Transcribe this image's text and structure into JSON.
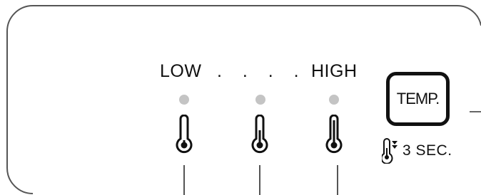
{
  "panel": {
    "level_low_label": "LOW",
    "level_dots": ". . . . .",
    "level_high_label": "HIGH",
    "indicators": [
      {
        "level": "low",
        "lit": false
      },
      {
        "level": "medium",
        "lit": false
      },
      {
        "level": "high",
        "lit": false
      }
    ],
    "temp_button_label": "TEMP.",
    "hold_duration_label": "3 SEC.",
    "icons": [
      "thermometer-low-icon",
      "thermometer-medium-icon",
      "thermometer-high-icon",
      "thermometer-down-icon"
    ],
    "colors": {
      "indicator_off": "#c4c4c4",
      "outline": "#111111"
    }
  }
}
